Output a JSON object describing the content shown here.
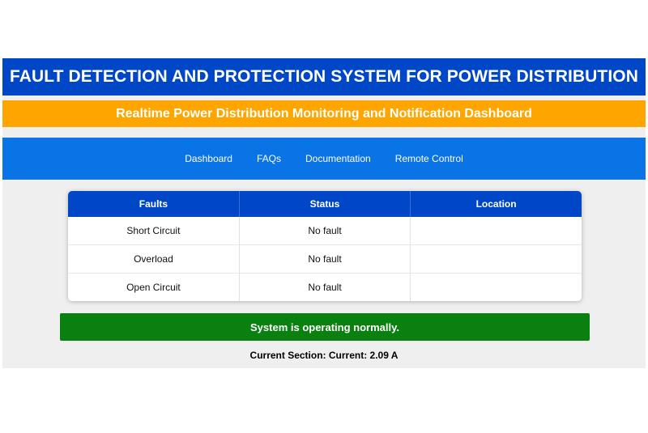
{
  "header": {
    "title": "FAULT DETECTION AND PROTECTION SYSTEM FOR POWER DISTRIBUTION",
    "subtitle": "Realtime Power Distribution Monitoring and Notification Dashboard"
  },
  "nav": {
    "items": [
      "Dashboard",
      "FAQs",
      "Documentation",
      "Remote Control"
    ]
  },
  "fault_table": {
    "columns": [
      "Faults",
      "Status",
      "Location"
    ],
    "rows": [
      {
        "fault": "Short Circuit",
        "status": "No fault",
        "location": ""
      },
      {
        "fault": "Overload",
        "status": "No fault",
        "location": ""
      },
      {
        "fault": "Open Circuit",
        "status": "No fault",
        "location": ""
      }
    ]
  },
  "status_banner": {
    "text": "System is operating normally."
  },
  "current": {
    "text": "Current Section: Current: 2.09 A"
  },
  "colors": {
    "title_bar": "#0047c8",
    "subtitle_bar": "#ffa500",
    "nav_bar": "#0a74e6",
    "status_ok": "#0a8010",
    "page_background": "#efefef"
  }
}
